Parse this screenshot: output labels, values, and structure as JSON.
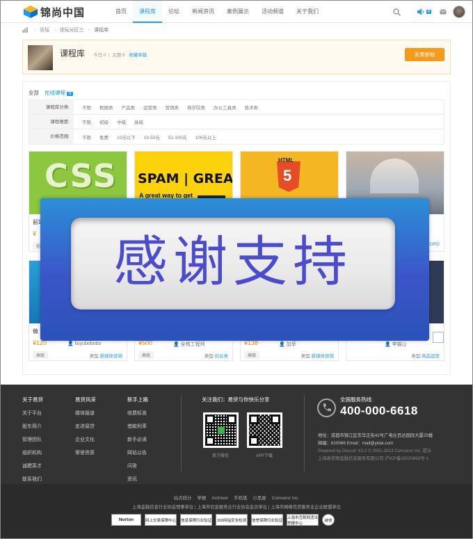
{
  "header": {
    "logo_text": "锦尚中国",
    "nav": [
      {
        "label": "首页",
        "active": false
      },
      {
        "label": "课程库",
        "active": true
      },
      {
        "label": "论坛",
        "active": false
      },
      {
        "label": "新闻资讯",
        "active": false
      },
      {
        "label": "案例展示",
        "active": false
      },
      {
        "label": "活动频道",
        "active": false
      },
      {
        "label": "关于我们",
        "active": false
      }
    ],
    "notify_count": "8",
    "icons": {
      "search": "search-icon",
      "notify": "speaker-icon",
      "mail": "mail-icon"
    }
  },
  "breadcrumb": [
    "论坛",
    "论坛分区三",
    "课程库"
  ],
  "forum": {
    "title": "课程库",
    "today_label": "今日:",
    "today_count": "0",
    "topics_label": "主题:",
    "topics_count": "6",
    "favorite": "收藏本版",
    "post_button": "发表新帖"
  },
  "tabs": [
    {
      "label": "全部",
      "active": false
    },
    {
      "label": "在线课程",
      "active": true,
      "badge": "8"
    }
  ],
  "filters": [
    {
      "label": "课程库分类:",
      "options": [
        "不限",
        "数据类",
        "产品类",
        "运营类",
        "营销类",
        "商学院类",
        "办公工具类",
        "技术类"
      ]
    },
    {
      "label": "课程难度:",
      "options": [
        "不限",
        "初级",
        "中级",
        "高级"
      ]
    },
    {
      "label": "价格范围:",
      "options": [
        "不限",
        "免费",
        "10元以下",
        "10-50元",
        "51-100元",
        "100元以上"
      ]
    }
  ],
  "cards_row1": [
    {
      "title": "前端",
      "price": "¥",
      "teacher": "",
      "level": "初",
      "type_label": "",
      "type": "",
      "img": "CSS"
    },
    {
      "title": "",
      "price": "",
      "teacher": "",
      "level": "",
      "type_label": "",
      "type": "",
      "img": "SPAM | GREAT!",
      "img_sub": "A great way to get"
    },
    {
      "title": "",
      "price": "",
      "teacher": "",
      "level": "",
      "type_label": "",
      "type": "",
      "img": "HTML"
    },
    {
      "title": "",
      "price": "",
      "teacher": "",
      "level": "",
      "type_label": "",
      "type": "ORD",
      "img": ""
    }
  ],
  "cards_row2": [
    {
      "title": "做",
      "price": "¥120",
      "teacher": "liuyubobobo",
      "level": "高级",
      "type_label": "类型:",
      "type": "新媒体营销"
    },
    {
      "title": "",
      "price": "¥500",
      "teacher": "全栈工程师",
      "level": "高级",
      "type_label": "类型:",
      "type": "创业类"
    },
    {
      "title": "",
      "price": "¥138",
      "teacher": "加菲",
      "level": "高级",
      "type_label": "类型:",
      "type": "新媒体营销"
    },
    {
      "title": "",
      "price": "",
      "teacher": "李猫山",
      "level": "",
      "type_label": "类型:",
      "type": "商品运营"
    }
  ],
  "overlay": {
    "text": "感谢支持"
  },
  "footer": {
    "cols": [
      {
        "head": "关于易贷",
        "items": [
          "关于平台",
          "股东简介",
          "管理团队",
          "组织机构",
          "诚聘英才",
          "联系我们"
        ]
      },
      {
        "head": "易贷风采",
        "items": [
          "媒体报道",
          "走进易贷",
          "企业文化",
          "荣誉资质"
        ]
      },
      {
        "head": "新手上路",
        "items": [
          "收费标准",
          "借款利率",
          "新手必读",
          "网站公告",
          "问答",
          "资讯"
        ]
      }
    ],
    "follow": "关注我们：易贷与你快乐分享",
    "qr_captions": [
      "官方微信",
      "APP下载"
    ],
    "hotline_label": "全国服务热线:",
    "hotline": "400-000-6618",
    "address": "地址：成都市锦江区东华正街42号广电仕百达国际大厦25楼",
    "contact": "邮编：610066 Email：mail@yidai.com",
    "powered": "Powered by Discuz! X3.2 © 2001-2013 Comsenz Inc.  提示",
    "company": "上海易贷网金融信息服务有限公司  沪ICP备15020893号-1"
  },
  "subfooter": {
    "links": [
      "站点统计",
      "举报",
      "Archiver",
      "手机版",
      "小黑屋",
      "Comsenz Inc."
    ],
    "units": "上海金融信息行业协会理事单位 | 上海市信息服务业行业协会会员单位 | 上海市网络信贷服务业企业联盟单位",
    "badges": [
      "Norton",
      "网上交易保障中心",
      "信息保障行业验证",
      "360网站安全检测",
      "信誉保障行业验证",
      "上海市互联网违法举报中心",
      "诚信"
    ]
  }
}
